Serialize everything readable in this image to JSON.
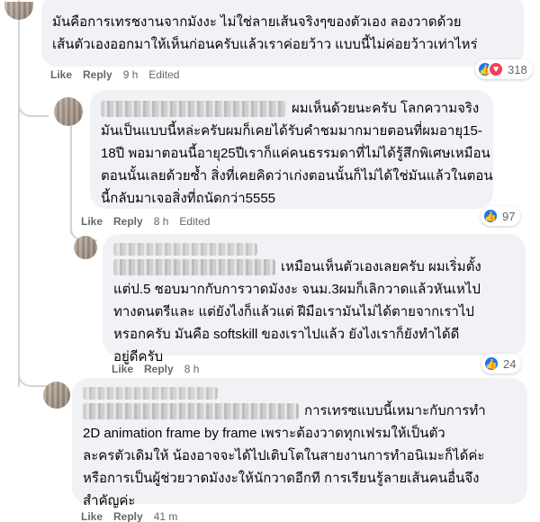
{
  "comments": [
    {
      "lines": [
        "มันคือการเทรชงานจากมังงะ ไม่ใช่ลายเส้นจริงๆของตัวเอง ลองวาดด้วย",
        "เส้นตัวเองออกมาให้เห็นก่อนครับแล้วเราค่อยว้าว แบบนี้ไม่ค่อยว้าวเท่าไหร่"
      ],
      "like_label": "Like",
      "reply_label": "Reply",
      "time": "9 h",
      "edited": "Edited",
      "reaction_icons": [
        "like-icon",
        "love-icon"
      ],
      "reaction_count": "318"
    },
    {
      "lines": [
        "ผมเห็นด้วยนะครับ โลกความจริง",
        "มันเป็นแบบนี้หล่ะครับผมก็เคยได้รับคำชมมากมายตอนที่ผมอายุ15-",
        "18ปี พอมาตอนนี้อายุ25ปีเราก็แค่คนธรรมดาที่ไม่ได้รู้สึกพิเศษเหมือน",
        "ตอนนั้นเลยด้วยซ้ำ สิ่งที่เคยคิดว่าเก่งตอนนั้นก็ไม่ได้ใช่มันแล้วในตอน",
        "นี้กลับมาเจอสิ่งที่ถนัดกว่า5555"
      ],
      "like_label": "Like",
      "reply_label": "Reply",
      "time": "8 h",
      "edited": "Edited",
      "reaction_icons": [
        "like-icon"
      ],
      "reaction_count": "97"
    },
    {
      "lines": [
        "เหมือนเห็นตัวเองเลยครับ ผมเริ่มตั้ง",
        "แต่ป.5 ชอบมากกับการวาดมังงะ จนม.3ผมก็เลิกวาดแล้วหันเหไป",
        "ทางดนตรีและ แต่ยังไงก็แล้วแต่ ฝีมือเรามันไม่ได้ตายจากเราไป",
        "หรอกครับ มันคือ softskill ของเราไปแล้ว ยังไงเราก็ยังทำได้ดี",
        "อยู่ดีครับ"
      ],
      "like_label": "Like",
      "reply_label": "Reply",
      "time": "8 h",
      "reaction_icons": [
        "like-icon"
      ],
      "reaction_count": "24"
    },
    {
      "lines": [
        "การเทรซแบบนี้เหมาะกับการทำ",
        "2D animation frame by frame เพราะต้องวาดทุกเฟรมให้เป็นตัว",
        "ละครตัวเดิมให้ น้องอาจจะได้ไปเติบโตในสายงานการทำอนิเมะก็ได้ค่ะ",
        "หรือการเป็นผู้ช่วยวาดมังงะให้นักวาดอีกที การเรียนรู้ลายเส้นคนอื่นจึง",
        "สำคัญค่ะ"
      ],
      "like_label": "Like",
      "reply_label": "Reply",
      "time": "41 m"
    }
  ],
  "colors": {
    "bubble": "#f0f2f5",
    "meta_text": "#65676b",
    "like_blue": "#1877f2",
    "love_red": "#f33e58"
  }
}
